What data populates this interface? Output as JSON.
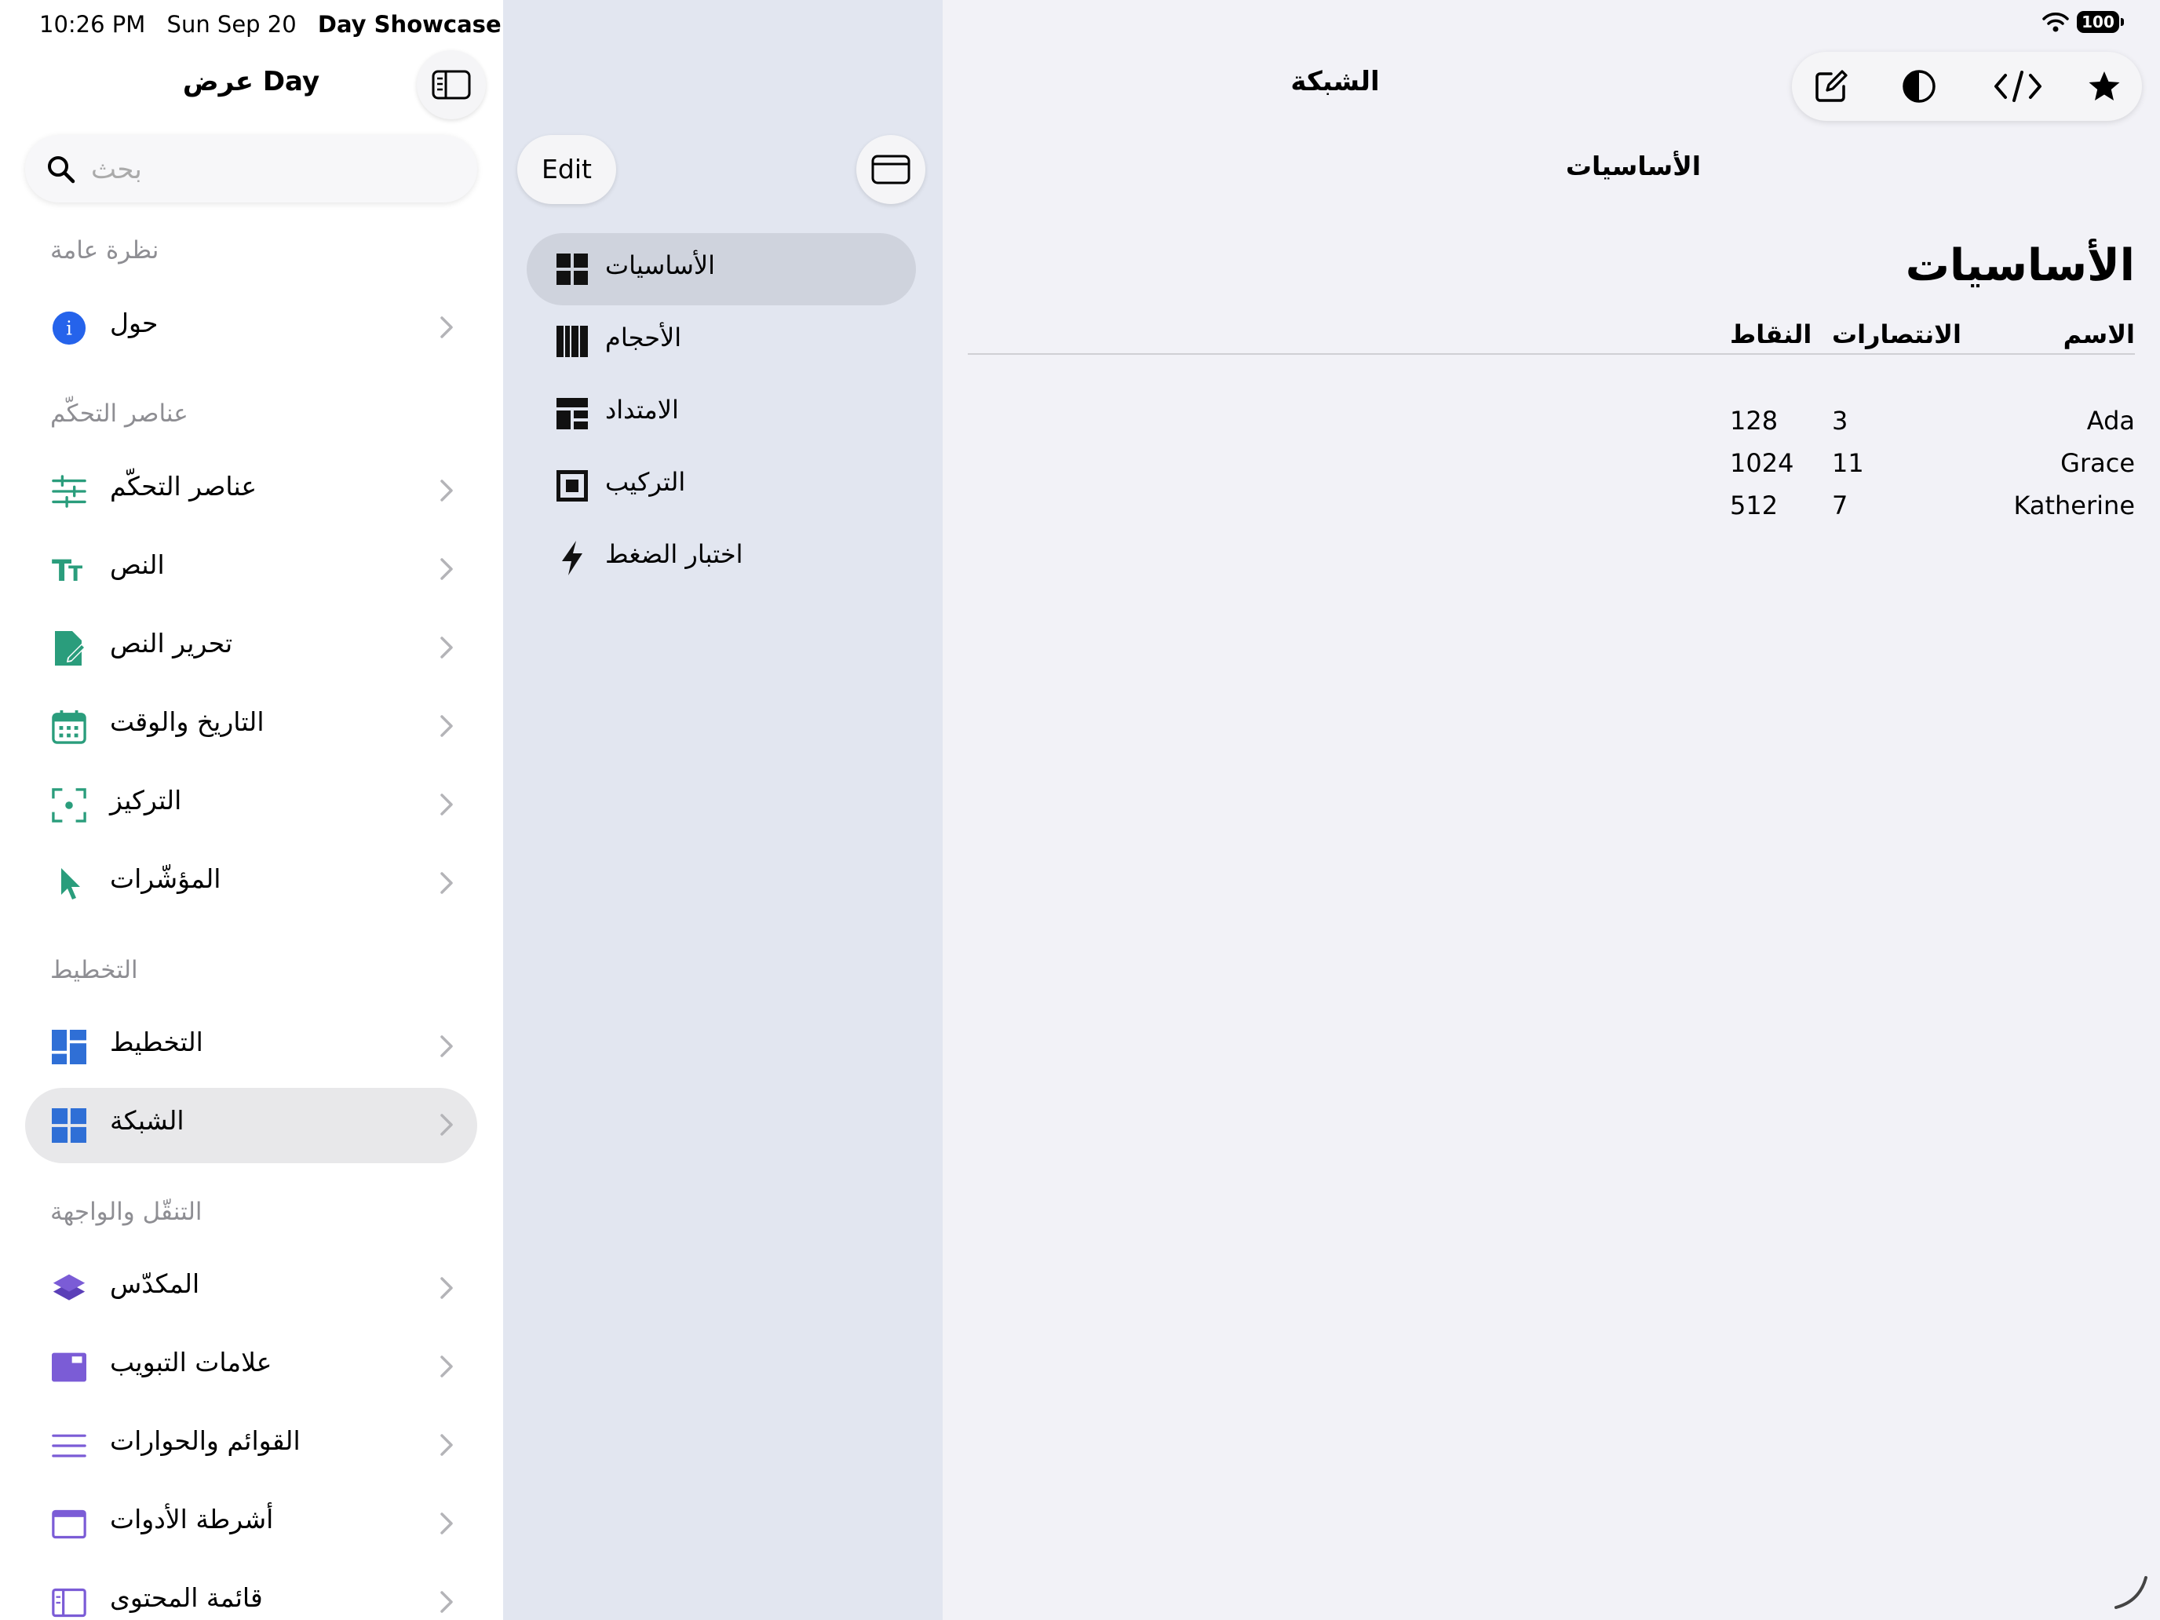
{
  "status_bar": {
    "time": "10:26 PM",
    "date": "Sun Sep 20",
    "app_name": "Day Showcase",
    "battery": "100"
  },
  "sidebar": {
    "title": "عرض Day",
    "search_placeholder": "بحث",
    "sections": [
      {
        "header": "نظرة عامة",
        "items": [
          {
            "label": "حول",
            "icon": "info-icon",
            "color": "#2563eb"
          }
        ]
      },
      {
        "header": "عناصر التحكّم",
        "items": [
          {
            "label": "عناصر التحكّم",
            "icon": "sliders-icon",
            "color": "#2a9d7c"
          },
          {
            "label": "النص",
            "icon": "text-size-icon",
            "color": "#2a9d7c"
          },
          {
            "label": "تحرير النص",
            "icon": "document-edit-icon",
            "color": "#2a9d7c"
          },
          {
            "label": "التاريخ والوقت",
            "icon": "calendar-icon",
            "color": "#2a9d7c"
          },
          {
            "label": "التركيز",
            "icon": "focus-icon",
            "color": "#2a9d7c"
          },
          {
            "label": "المؤشّرات",
            "icon": "pointer-icon",
            "color": "#2a9d7c"
          }
        ]
      },
      {
        "header": "التخطيط",
        "items": [
          {
            "label": "التخطيط",
            "icon": "layout-icon",
            "color": "#2f6fd6"
          },
          {
            "label": "الشبكة",
            "icon": "grid-icon",
            "color": "#2f6fd6",
            "selected": true
          }
        ]
      },
      {
        "header": "التنقّل والواجهة",
        "items": [
          {
            "label": "المكدّس",
            "icon": "stack-icon",
            "color": "#7b5cd6"
          },
          {
            "label": "علامات التبويب",
            "icon": "tabs-icon",
            "color": "#7b5cd6"
          },
          {
            "label": "القوائم والحوارات",
            "icon": "list-icon",
            "color": "#7b5cd6"
          },
          {
            "label": "أشرطة الأدوات",
            "icon": "toolbar-icon",
            "color": "#7b5cd6"
          },
          {
            "label": "قائمة المحتوى",
            "icon": "content-list-icon",
            "color": "#7b5cd6"
          }
        ]
      }
    ]
  },
  "middle": {
    "edit_label": "Edit",
    "items": [
      {
        "label": "الأساسيات",
        "icon": "grid-basics-icon",
        "selected": true
      },
      {
        "label": "الأحجام",
        "icon": "columns-icon"
      },
      {
        "label": "الامتداد",
        "icon": "span-icon"
      },
      {
        "label": "التركيب",
        "icon": "nested-icon"
      },
      {
        "label": "اختبار الضغط",
        "icon": "bolt-icon"
      }
    ]
  },
  "detail": {
    "nav_title": "الشبكة",
    "subtitle": "الأساسيات",
    "heading": "الأساسيات",
    "table": {
      "headers": {
        "name": "الاسم",
        "wins": "الانتصارات",
        "points": "النقاط"
      },
      "rows": [
        {
          "name": "Ada",
          "wins": "3",
          "points": "128"
        },
        {
          "name": "Grace",
          "wins": "11",
          "points": "1024"
        },
        {
          "name": "Katherine",
          "wins": "7",
          "points": "512"
        }
      ]
    }
  }
}
